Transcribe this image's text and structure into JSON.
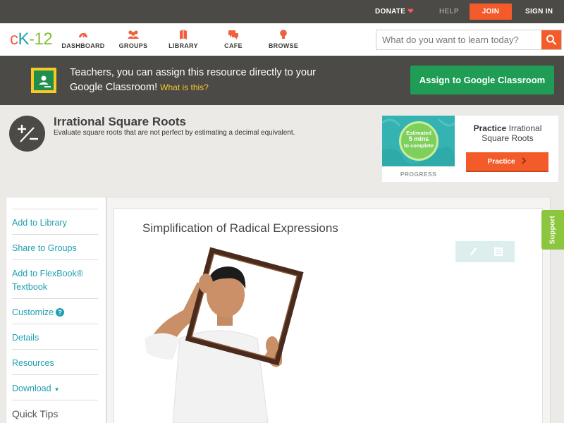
{
  "topbar": {
    "donate_label": "DONATE",
    "help_label": "HELP",
    "join_label": "JOIN",
    "signin_label": "SIGN IN"
  },
  "logo": {
    "c": "c",
    "k": "K",
    "dash": "-",
    "num": "12"
  },
  "nav": {
    "items": [
      {
        "label": "DASHBOARD",
        "icon": "dashboard-gauge-icon"
      },
      {
        "label": "GROUPS",
        "icon": "groups-people-icon"
      },
      {
        "label": "LIBRARY",
        "icon": "library-book-icon"
      },
      {
        "label": "CAFE",
        "icon": "cafe-chat-icon"
      },
      {
        "label": "BROWSE",
        "icon": "browse-bulb-icon"
      }
    ]
  },
  "search": {
    "placeholder": "What do you want to learn today?",
    "value": ""
  },
  "google_banner": {
    "text": "Teachers, you can assign this resource directly to your Google Classroom!",
    "what_link": "What is this?",
    "button_label": "Assign to Google Classroom"
  },
  "concept": {
    "title": "Irrational Square Roots",
    "description": "Evaluate square roots that are not perfect by estimating a decimal equivalent."
  },
  "practice_card": {
    "estimated": "Estimated",
    "mins": "5 mins",
    "to_complete": "to complete",
    "progress_label": "PROGRESS",
    "title_bold": "Practice",
    "title_rest": "Irrational Square Roots",
    "button_label": "Practice"
  },
  "sidebar": {
    "add_library": "Add to Library",
    "share_groups": "Share to Groups",
    "add_flexbook": "Add to FlexBook® Textbook",
    "customize": "Customize",
    "details": "Details",
    "resources": "Resources",
    "download": "Download",
    "quick_tips": "Quick Tips"
  },
  "content": {
    "title": "Simplification of Radical Expressions"
  },
  "support_label": "Support",
  "colors": {
    "accent_orange": "#f35b2a",
    "teal_link": "#1f9fb1",
    "google_green": "#1f9d55",
    "support_green": "#8cc63f",
    "dark_bar": "#4b4a46"
  }
}
